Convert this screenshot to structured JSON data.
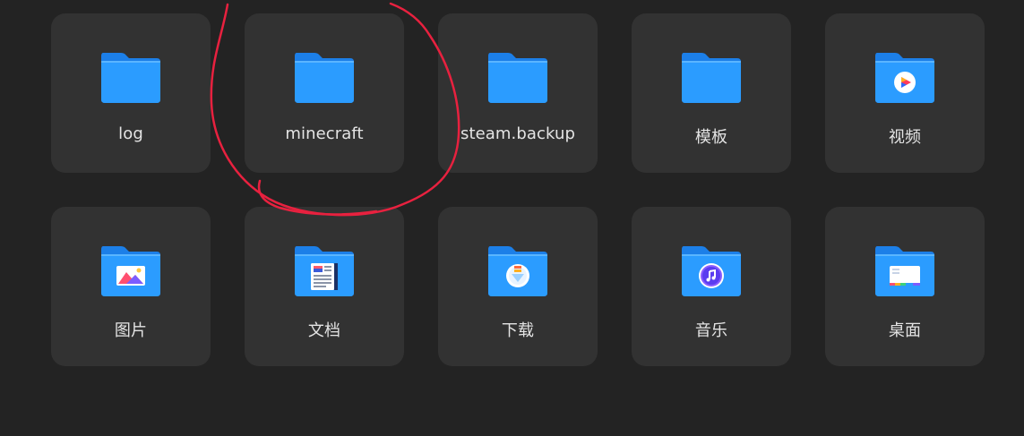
{
  "folders": [
    {
      "label": "log",
      "icon": "folder-icon"
    },
    {
      "label": "minecraft",
      "icon": "folder-icon"
    },
    {
      "label": "steam.backup",
      "icon": "folder-icon"
    },
    {
      "label": "模板",
      "icon": "folder-icon"
    },
    {
      "label": "视频",
      "icon": "video-folder-icon"
    },
    {
      "label": "图片",
      "icon": "pictures-folder-icon"
    },
    {
      "label": "文档",
      "icon": "documents-folder-icon"
    },
    {
      "label": "下载",
      "icon": "downloads-folder-icon"
    },
    {
      "label": "音乐",
      "icon": "music-folder-icon"
    },
    {
      "label": "桌面",
      "icon": "desktop-folder-icon"
    }
  ],
  "colors": {
    "background": "#232323",
    "tile": "#323232",
    "folder_back": "#1f86f0",
    "folder_front": "#2a9bff",
    "label": "#e4e4e4",
    "annotation": "#e8213f"
  }
}
